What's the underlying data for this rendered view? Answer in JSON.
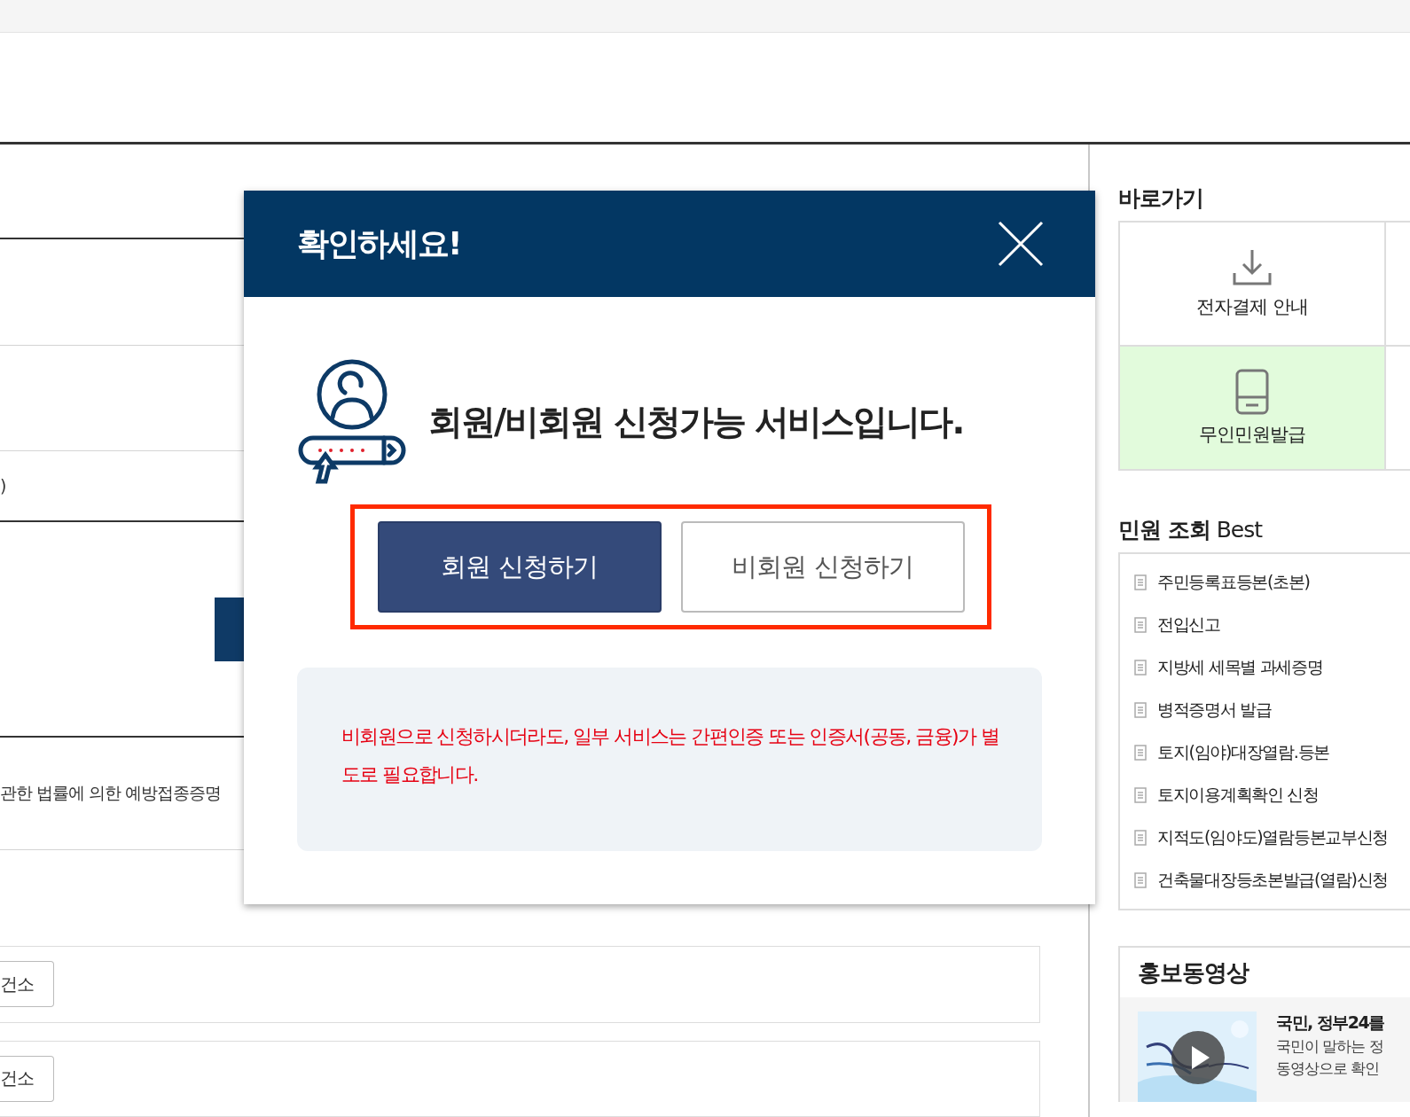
{
  "background_form": {
    "row_texts": [
      ")",
      "관한 법률에 의한 예방접종증명"
    ],
    "office_buttons": [
      "건소",
      "건소"
    ]
  },
  "modal": {
    "title": "확인하세요!",
    "heading": "회원/비회원 신청가능 서비스입니다.",
    "buttons": [
      {
        "label": "회원 신청하기",
        "kind": "primary"
      },
      {
        "label": "비회원 신청하기",
        "kind": "secondary"
      }
    ],
    "notice": "비회원으로 신청하시더라도, 일부 서비스는 간편인증 또는 인증서(공동, 금융)가 별도로 필요합니다."
  },
  "sidebar": {
    "shortcuts_title": "바로가기",
    "shortcuts": [
      {
        "label": "전자결제 안내",
        "kind": "download",
        "highlighted": false
      },
      {
        "label": "무인민원발급",
        "kind": "kiosk",
        "highlighted": true
      }
    ],
    "best_title": "**민원 조회** Best",
    "best_items": [
      "주민등록표등본(초본)",
      "전입신고",
      "지방세 세목별 과세증명",
      "병적증명서 발급",
      "토지(임야)대장열람.등본",
      "토지이용계획확인 신청",
      "지적도(임야도)열람등본교부신청",
      "건축물대장등초본발급(열람)신청"
    ],
    "promo": {
      "title": "홍보동영상",
      "video_title": "국민, 정부24를",
      "video_lines": [
        "국민이 말하는 정",
        "동영상으로 확인"
      ]
    }
  }
}
